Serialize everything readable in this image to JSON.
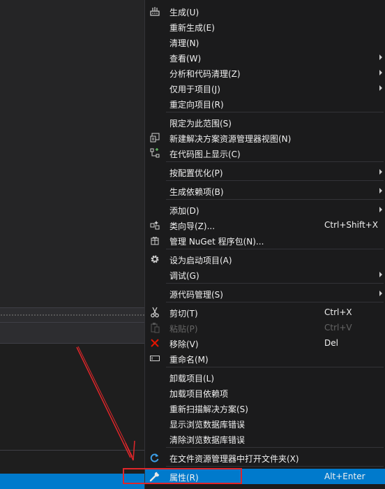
{
  "context_menu": {
    "items": {
      "build": {
        "label": "生成(U)",
        "icon": "build-icon"
      },
      "rebuild": {
        "label": "重新生成(E)"
      },
      "clean": {
        "label": "清理(N)"
      },
      "view": {
        "label": "查看(W)"
      },
      "analyze": {
        "label": "分析和代码清理(Z)"
      },
      "project_only": {
        "label": "仅用于项目(J)"
      },
      "retarget": {
        "label": "重定向项目(R)"
      },
      "scope": {
        "label": "限定为此范围(S)"
      },
      "new_view": {
        "label": "新建解决方案资源管理器视图(N)",
        "icon": "new-solution-view-icon"
      },
      "code_map": {
        "label": "在代码图上显示(C)",
        "icon": "code-map-icon"
      },
      "pgo": {
        "label": "按配置优化(P)"
      },
      "build_deps": {
        "label": "生成依赖项(B)"
      },
      "add": {
        "label": "添加(D)"
      },
      "class_wizard": {
        "label": "类向导(Z)...",
        "shortcut": "Ctrl+Shift+X",
        "icon": "class-wizard-icon"
      },
      "nuget": {
        "label": "管理 NuGet 程序包(N)...",
        "icon": "nuget-icon"
      },
      "startup": {
        "label": "设为启动项目(A)",
        "icon": "gear-icon"
      },
      "debug": {
        "label": "调试(G)"
      },
      "source_control": {
        "label": "源代码管理(S)"
      },
      "cut": {
        "label": "剪切(T)",
        "shortcut": "Ctrl+X",
        "icon": "scissors-icon"
      },
      "paste": {
        "label": "粘贴(P)",
        "shortcut": "Ctrl+V",
        "icon": "paste-icon"
      },
      "remove": {
        "label": "移除(V)",
        "shortcut": "Del",
        "icon": "remove-icon"
      },
      "rename": {
        "label": "重命名(M)",
        "icon": "rename-icon"
      },
      "unload": {
        "label": "卸载项目(L)"
      },
      "load_deps": {
        "label": "加载项目依赖项"
      },
      "rescan": {
        "label": "重新扫描解决方案(S)"
      },
      "show_db_errors": {
        "label": "显示浏览数据库错误"
      },
      "clear_db_errors": {
        "label": "清除浏览数据库错误"
      },
      "open_in_explorer": {
        "label": "在文件资源管理器中打开文件夹(X)",
        "icon": "refresh-arrow-icon"
      },
      "properties": {
        "label": "属性(R)",
        "shortcut": "Alt+Enter",
        "icon": "wrench-icon"
      }
    }
  },
  "colors": {
    "menu_bg": "#1b1b1c",
    "highlight": "#007acc",
    "annotation": "#e0262a",
    "remove_icon": "#e51400",
    "refresh_icon": "#3c9fe8"
  }
}
